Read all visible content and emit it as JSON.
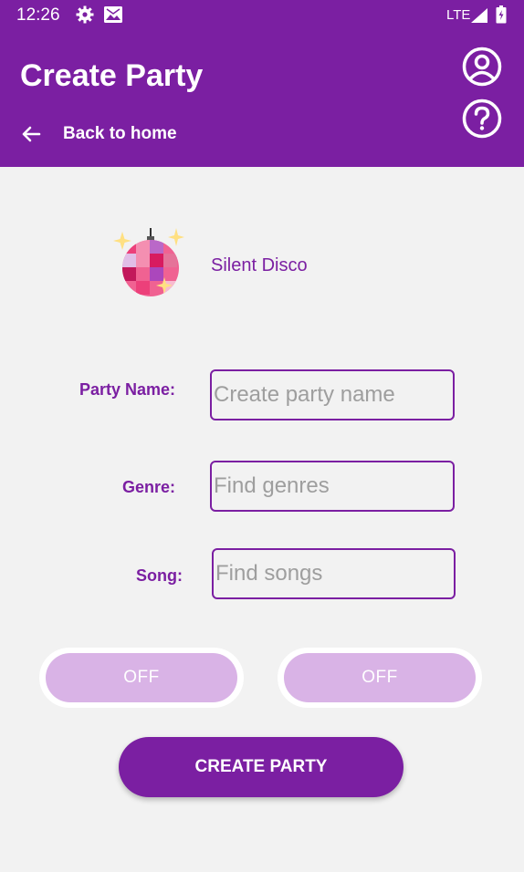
{
  "status_bar": {
    "time": "12:26",
    "network": "LTE",
    "icons": [
      "gear-icon",
      "image-icon",
      "signal-icon",
      "battery-icon"
    ]
  },
  "app_bar": {
    "title": "Create Party",
    "back_label": "Back to home",
    "icons": [
      "back-arrow-icon",
      "profile-icon",
      "help-icon"
    ]
  },
  "party": {
    "theme_label": "Silent Disco",
    "theme_icon": "disco-ball-icon"
  },
  "form": {
    "name_label": "Party Name:",
    "name_placeholder": "Create party name",
    "name_value": "",
    "genre_label": "Genre:",
    "genre_placeholder": "Find genres",
    "genre_value": "",
    "song_label": "Song:",
    "song_placeholder": "Find songs",
    "song_value": ""
  },
  "toggles": [
    {
      "label": "OFF"
    },
    {
      "label": "OFF"
    }
  ],
  "actions": {
    "create_label": "CREATE PARTY"
  },
  "colors": {
    "primary": "#7b1fa2",
    "toggle_off": "#d9b3e6",
    "background": "#f2f2f2"
  }
}
